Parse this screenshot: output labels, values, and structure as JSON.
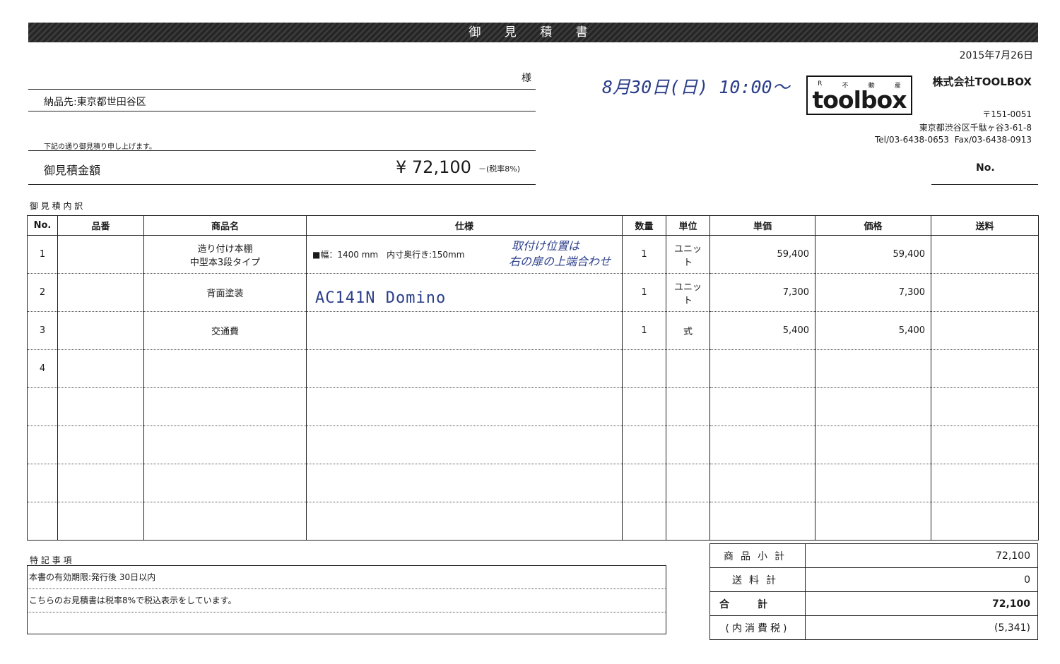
{
  "title": "御 見 積 書",
  "date": "2015年7月26日",
  "client": {
    "honorific": "様",
    "delivery_label": "納品先:",
    "delivery_address": "東京都世田谷区"
  },
  "note_line": "下記の通り御見積り申し上げます。",
  "total": {
    "label": "御見積金額",
    "amount": "¥ 72,100",
    "tax_note": "－(税率8%)"
  },
  "handwritten": {
    "appointment": "8月30日(日) 10:00～",
    "item1_note_line1": "取付け位置は",
    "item1_note_line2": "右の扉の上端合わせ",
    "item2_spec": "AC141N Domino"
  },
  "company": {
    "logo_kana": [
      "R",
      "不",
      "動",
      "産"
    ],
    "logo_word": "toolbox",
    "name": "株式会社TOOLBOX",
    "postal": "〒151-0051",
    "address": "東京都渋谷区千駄ヶ谷3-61-8",
    "phone_fax": "Tel/03-6438-0653  Fax/03-6438-0913",
    "no_label": "No."
  },
  "breakdown_label": "御 見 積 内 訳",
  "table": {
    "headers": [
      "No.",
      "品番",
      "商品名",
      "仕様",
      "数量",
      "単位",
      "単価",
      "価格",
      "送料"
    ],
    "rows": [
      {
        "no": "1",
        "code": "",
        "name_line1": "造り付け本棚",
        "name_line2": "中型本3段タイプ",
        "spec": "■幅：1400 mm　内寸奥行き:150mm",
        "qty": "1",
        "unit": "ユニット",
        "price": "59,400",
        "amount": "59,400",
        "shipping": ""
      },
      {
        "no": "2",
        "code": "",
        "name_line1": "背面塗装",
        "name_line2": "",
        "spec": "",
        "qty": "1",
        "unit": "ユニット",
        "price": "7,300",
        "amount": "7,300",
        "shipping": ""
      },
      {
        "no": "3",
        "code": "",
        "name_line1": "交通費",
        "name_line2": "",
        "spec": "",
        "qty": "1",
        "unit": "式",
        "price": "5,400",
        "amount": "5,400",
        "shipping": ""
      },
      {
        "no": "4",
        "code": "",
        "name_line1": "",
        "name_line2": "",
        "spec": "",
        "qty": "",
        "unit": "",
        "price": "",
        "amount": "",
        "shipping": ""
      },
      {
        "no": "",
        "code": "",
        "name_line1": "",
        "name_line2": "",
        "spec": "",
        "qty": "",
        "unit": "",
        "price": "",
        "amount": "",
        "shipping": ""
      },
      {
        "no": "",
        "code": "",
        "name_line1": "",
        "name_line2": "",
        "spec": "",
        "qty": "",
        "unit": "",
        "price": "",
        "amount": "",
        "shipping": ""
      },
      {
        "no": "",
        "code": "",
        "name_line1": "",
        "name_line2": "",
        "spec": "",
        "qty": "",
        "unit": "",
        "price": "",
        "amount": "",
        "shipping": ""
      },
      {
        "no": "",
        "code": "",
        "name_line1": "",
        "name_line2": "",
        "spec": "",
        "qty": "",
        "unit": "",
        "price": "",
        "amount": "",
        "shipping": ""
      }
    ]
  },
  "notes": {
    "label": "特 記 事 項",
    "lines": [
      "本書の有効期限:発行後 30日以内",
      "こちらのお見積書は税率8%で税込表示をしています。",
      ""
    ]
  },
  "totals": {
    "subtotal_label": "商品小計",
    "subtotal": "72,100",
    "shipping_label": "送料計",
    "shipping": "0",
    "total_label": "合計",
    "total": "72,100",
    "tax_label": "(内消費税)",
    "tax": "(5,341)"
  },
  "colors": {
    "handwriting": "#2c3f8a",
    "title_bar": "#2e2e2e"
  }
}
